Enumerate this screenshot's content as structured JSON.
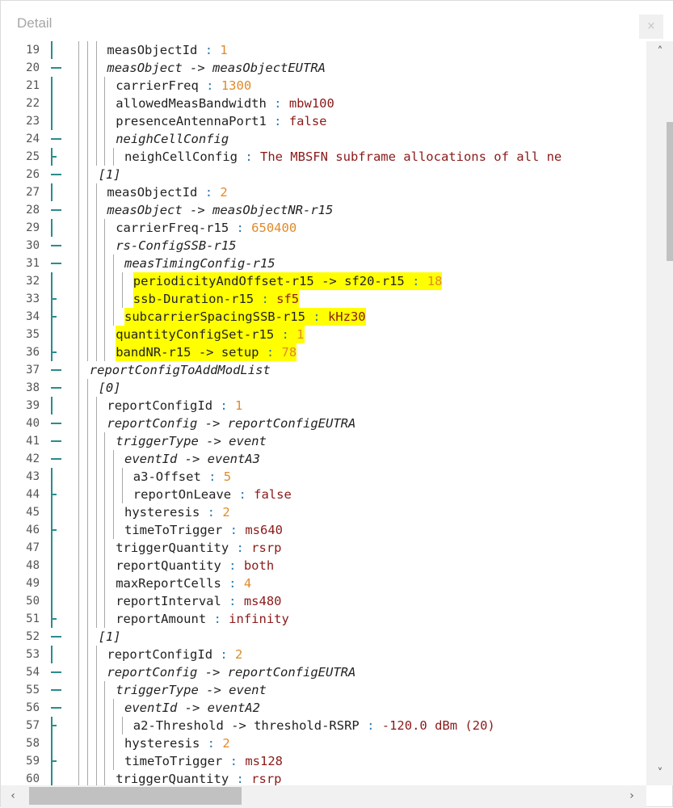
{
  "window": {
    "title": "Detail",
    "close_label": "×"
  },
  "scroll": {
    "up": "˄",
    "down": "˅",
    "left": "‹",
    "right": "›"
  },
  "colors": {
    "gutter": "#2a8c8c",
    "highlight": "#ffff00",
    "key": "#222222",
    "value": "#8a1a1a",
    "number": "#e08a2a",
    "separator": "#2a7ab0"
  },
  "lines": [
    {
      "num": "19",
      "marker": "bar",
      "depth": 3,
      "parts": [
        {
          "t": "measObjectId",
          "c": "k"
        },
        {
          "t": " : ",
          "c": "s"
        },
        {
          "t": "1",
          "c": "n"
        }
      ]
    },
    {
      "num": "20",
      "marker": "open",
      "depth": 3,
      "parts": [
        {
          "t": "measObject -> measObjectEUTRA",
          "c": "i"
        }
      ]
    },
    {
      "num": "21",
      "marker": "bar",
      "depth": 4,
      "parts": [
        {
          "t": "carrierFreq",
          "c": "k"
        },
        {
          "t": " : ",
          "c": "s"
        },
        {
          "t": "1300",
          "c": "n"
        }
      ]
    },
    {
      "num": "22",
      "marker": "bar",
      "depth": 4,
      "parts": [
        {
          "t": "allowedMeasBandwidth",
          "c": "k"
        },
        {
          "t": " : ",
          "c": "s"
        },
        {
          "t": "mbw100",
          "c": "v"
        }
      ]
    },
    {
      "num": "23",
      "marker": "bar",
      "depth": 4,
      "parts": [
        {
          "t": "presenceAntennaPort1",
          "c": "k"
        },
        {
          "t": " : ",
          "c": "s"
        },
        {
          "t": "false",
          "c": "v"
        }
      ]
    },
    {
      "num": "24",
      "marker": "open",
      "depth": 4,
      "parts": [
        {
          "t": "neighCellConfig",
          "c": "i"
        }
      ]
    },
    {
      "num": "25",
      "marker": "tee",
      "depth": 5,
      "parts": [
        {
          "t": "neighCellConfig",
          "c": "k"
        },
        {
          "t": " : ",
          "c": "s"
        },
        {
          "t": "The MBSFN subframe allocations of all ne",
          "c": "v"
        }
      ]
    },
    {
      "num": "26",
      "marker": "open",
      "depth": 2,
      "parts": [
        {
          "t": "[1]",
          "c": "i"
        }
      ]
    },
    {
      "num": "27",
      "marker": "bar",
      "depth": 3,
      "parts": [
        {
          "t": "measObjectId",
          "c": "k"
        },
        {
          "t": " : ",
          "c": "s"
        },
        {
          "t": "2",
          "c": "n"
        }
      ]
    },
    {
      "num": "28",
      "marker": "open",
      "depth": 3,
      "parts": [
        {
          "t": "measObject -> measObjectNR-r15",
          "c": "i"
        }
      ]
    },
    {
      "num": "29",
      "marker": "bar",
      "depth": 4,
      "parts": [
        {
          "t": "carrierFreq-r15",
          "c": "k"
        },
        {
          "t": " : ",
          "c": "s"
        },
        {
          "t": "650400",
          "c": "n"
        }
      ]
    },
    {
      "num": "30",
      "marker": "open",
      "depth": 4,
      "parts": [
        {
          "t": "rs-ConfigSSB-r15",
          "c": "i"
        }
      ]
    },
    {
      "num": "31",
      "marker": "open",
      "depth": 5,
      "parts": [
        {
          "t": "measTimingConfig-r15",
          "c": "i"
        }
      ]
    },
    {
      "num": "32",
      "marker": "bar",
      "depth": 6,
      "hl": true,
      "parts": [
        {
          "t": "periodicityAndOffset-r15 -> sf20-r15",
          "c": "k"
        },
        {
          "t": " : ",
          "c": "s"
        },
        {
          "t": "18",
          "c": "n"
        }
      ]
    },
    {
      "num": "33",
      "marker": "tee",
      "depth": 6,
      "hl": true,
      "parts": [
        {
          "t": "ssb-Duration-r15",
          "c": "k"
        },
        {
          "t": " : ",
          "c": "s"
        },
        {
          "t": "sf5",
          "c": "v"
        }
      ]
    },
    {
      "num": "34",
      "marker": "tee",
      "depth": 5,
      "hl": true,
      "parts": [
        {
          "t": "subcarrierSpacingSSB-r15",
          "c": "k"
        },
        {
          "t": " : ",
          "c": "s"
        },
        {
          "t": "kHz30",
          "c": "v"
        }
      ]
    },
    {
      "num": "35",
      "marker": "bar",
      "depth": 4,
      "hl": true,
      "parts": [
        {
          "t": "quantityConfigSet-r15",
          "c": "k"
        },
        {
          "t": " : ",
          "c": "s"
        },
        {
          "t": "1",
          "c": "n"
        }
      ]
    },
    {
      "num": "36",
      "marker": "tee",
      "depth": 4,
      "hl": true,
      "parts": [
        {
          "t": "bandNR-r15 -> setup",
          "c": "k"
        },
        {
          "t": " : ",
          "c": "s"
        },
        {
          "t": "78",
          "c": "n"
        }
      ]
    },
    {
      "num": "37",
      "marker": "open",
      "depth": 1,
      "parts": [
        {
          "t": "reportConfigToAddModList",
          "c": "i"
        }
      ]
    },
    {
      "num": "38",
      "marker": "open",
      "depth": 2,
      "parts": [
        {
          "t": "[0]",
          "c": "i"
        }
      ]
    },
    {
      "num": "39",
      "marker": "bar",
      "depth": 3,
      "parts": [
        {
          "t": "reportConfigId",
          "c": "k"
        },
        {
          "t": " : ",
          "c": "s"
        },
        {
          "t": "1",
          "c": "n"
        }
      ]
    },
    {
      "num": "40",
      "marker": "open",
      "depth": 3,
      "parts": [
        {
          "t": "reportConfig -> reportConfigEUTRA",
          "c": "i"
        }
      ]
    },
    {
      "num": "41",
      "marker": "open",
      "depth": 4,
      "parts": [
        {
          "t": "triggerType -> event",
          "c": "i"
        }
      ]
    },
    {
      "num": "42",
      "marker": "open",
      "depth": 5,
      "parts": [
        {
          "t": "eventId -> eventA3",
          "c": "i"
        }
      ]
    },
    {
      "num": "43",
      "marker": "bar",
      "depth": 6,
      "parts": [
        {
          "t": "a3-Offset",
          "c": "k"
        },
        {
          "t": " : ",
          "c": "s"
        },
        {
          "t": "5",
          "c": "n"
        }
      ]
    },
    {
      "num": "44",
      "marker": "tee",
      "depth": 6,
      "parts": [
        {
          "t": "reportOnLeave",
          "c": "k"
        },
        {
          "t": " : ",
          "c": "s"
        },
        {
          "t": "false",
          "c": "v"
        }
      ]
    },
    {
      "num": "45",
      "marker": "bar",
      "depth": 5,
      "parts": [
        {
          "t": "hysteresis",
          "c": "k"
        },
        {
          "t": " : ",
          "c": "s"
        },
        {
          "t": "2",
          "c": "n"
        }
      ]
    },
    {
      "num": "46",
      "marker": "tee",
      "depth": 5,
      "parts": [
        {
          "t": "timeToTrigger",
          "c": "k"
        },
        {
          "t": " : ",
          "c": "s"
        },
        {
          "t": "ms640",
          "c": "v"
        }
      ]
    },
    {
      "num": "47",
      "marker": "bar",
      "depth": 4,
      "parts": [
        {
          "t": "triggerQuantity",
          "c": "k"
        },
        {
          "t": " : ",
          "c": "s"
        },
        {
          "t": "rsrp",
          "c": "v"
        }
      ]
    },
    {
      "num": "48",
      "marker": "bar",
      "depth": 4,
      "parts": [
        {
          "t": "reportQuantity",
          "c": "k"
        },
        {
          "t": " : ",
          "c": "s"
        },
        {
          "t": "both",
          "c": "v"
        }
      ]
    },
    {
      "num": "49",
      "marker": "bar",
      "depth": 4,
      "parts": [
        {
          "t": "maxReportCells",
          "c": "k"
        },
        {
          "t": " : ",
          "c": "s"
        },
        {
          "t": "4",
          "c": "n"
        }
      ]
    },
    {
      "num": "50",
      "marker": "bar",
      "depth": 4,
      "parts": [
        {
          "t": "reportInterval",
          "c": "k"
        },
        {
          "t": " : ",
          "c": "s"
        },
        {
          "t": "ms480",
          "c": "v"
        }
      ]
    },
    {
      "num": "51",
      "marker": "tee",
      "depth": 4,
      "parts": [
        {
          "t": "reportAmount",
          "c": "k"
        },
        {
          "t": " : ",
          "c": "s"
        },
        {
          "t": "infinity",
          "c": "v"
        }
      ]
    },
    {
      "num": "52",
      "marker": "open",
      "depth": 2,
      "parts": [
        {
          "t": "[1]",
          "c": "i"
        }
      ]
    },
    {
      "num": "53",
      "marker": "bar",
      "depth": 3,
      "parts": [
        {
          "t": "reportConfigId",
          "c": "k"
        },
        {
          "t": " : ",
          "c": "s"
        },
        {
          "t": "2",
          "c": "n"
        }
      ]
    },
    {
      "num": "54",
      "marker": "open",
      "depth": 3,
      "parts": [
        {
          "t": "reportConfig -> reportConfigEUTRA",
          "c": "i"
        }
      ]
    },
    {
      "num": "55",
      "marker": "open",
      "depth": 4,
      "parts": [
        {
          "t": "triggerType -> event",
          "c": "i"
        }
      ]
    },
    {
      "num": "56",
      "marker": "open",
      "depth": 5,
      "parts": [
        {
          "t": "eventId -> eventA2",
          "c": "i"
        }
      ]
    },
    {
      "num": "57",
      "marker": "tee",
      "depth": 6,
      "parts": [
        {
          "t": "a2-Threshold -> threshold-RSRP",
          "c": "k"
        },
        {
          "t": " : ",
          "c": "s"
        },
        {
          "t": "-120.0 dBm (20)",
          "c": "v"
        }
      ]
    },
    {
      "num": "58",
      "marker": "bar",
      "depth": 5,
      "parts": [
        {
          "t": "hysteresis",
          "c": "k"
        },
        {
          "t": " : ",
          "c": "s"
        },
        {
          "t": "2",
          "c": "n"
        }
      ]
    },
    {
      "num": "59",
      "marker": "tee",
      "depth": 5,
      "parts": [
        {
          "t": "timeToTrigger",
          "c": "k"
        },
        {
          "t": " : ",
          "c": "s"
        },
        {
          "t": "ms128",
          "c": "v"
        }
      ]
    },
    {
      "num": "60",
      "marker": "bar",
      "depth": 4,
      "parts": [
        {
          "t": "triggerQuantity",
          "c": "k"
        },
        {
          "t": " : ",
          "c": "s"
        },
        {
          "t": "rsrp",
          "c": "v"
        }
      ]
    }
  ]
}
